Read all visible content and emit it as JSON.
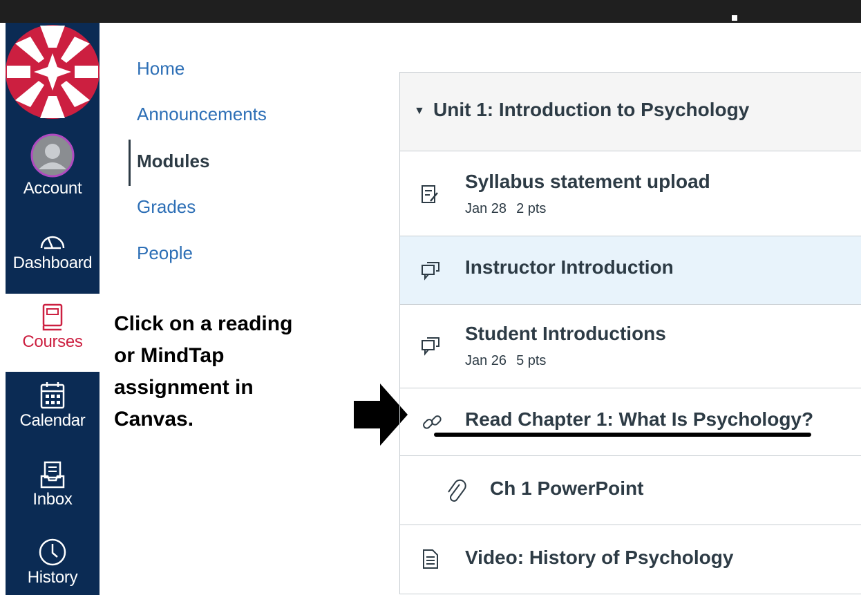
{
  "global_nav": {
    "items": [
      {
        "label": "Account",
        "icon": "account-avatar-icon"
      },
      {
        "label": "Dashboard",
        "icon": "dashboard-gauge-icon"
      },
      {
        "label": "Courses",
        "icon": "book-icon",
        "active": true
      },
      {
        "label": "Calendar",
        "icon": "calendar-icon"
      },
      {
        "label": "Inbox",
        "icon": "inbox-icon"
      },
      {
        "label": "History",
        "icon": "clock-icon"
      }
    ],
    "colors": {
      "background": "#0b2b54",
      "active": "#cc1f40",
      "logo": "#cc1f40"
    }
  },
  "course_nav": {
    "links": [
      "Home",
      "Announcements",
      "Modules",
      "Grades",
      "People"
    ],
    "current": "Modules"
  },
  "instruction": {
    "lines": [
      "Click on a reading",
      "or MindTap",
      "assignment in",
      "Canvas."
    ]
  },
  "module": {
    "title": "Unit 1: Introduction to Psychology",
    "items": [
      {
        "name": "Syllabus statement upload",
        "icon": "assignment-icon",
        "date": "Jan 28",
        "points": "2 pts"
      },
      {
        "name": "Instructor Introduction",
        "icon": "discussion-icon"
      },
      {
        "name": "Student Introductions",
        "icon": "discussion-icon",
        "date": "Jan 26",
        "points": "5 pts"
      },
      {
        "name": "Read Chapter 1: What Is Psychology?",
        "icon": "link-icon"
      },
      {
        "name": "Ch 1 PowerPoint",
        "icon": "paperclip-icon"
      },
      {
        "name": "Video: History of Psychology",
        "icon": "page-icon"
      }
    ]
  }
}
